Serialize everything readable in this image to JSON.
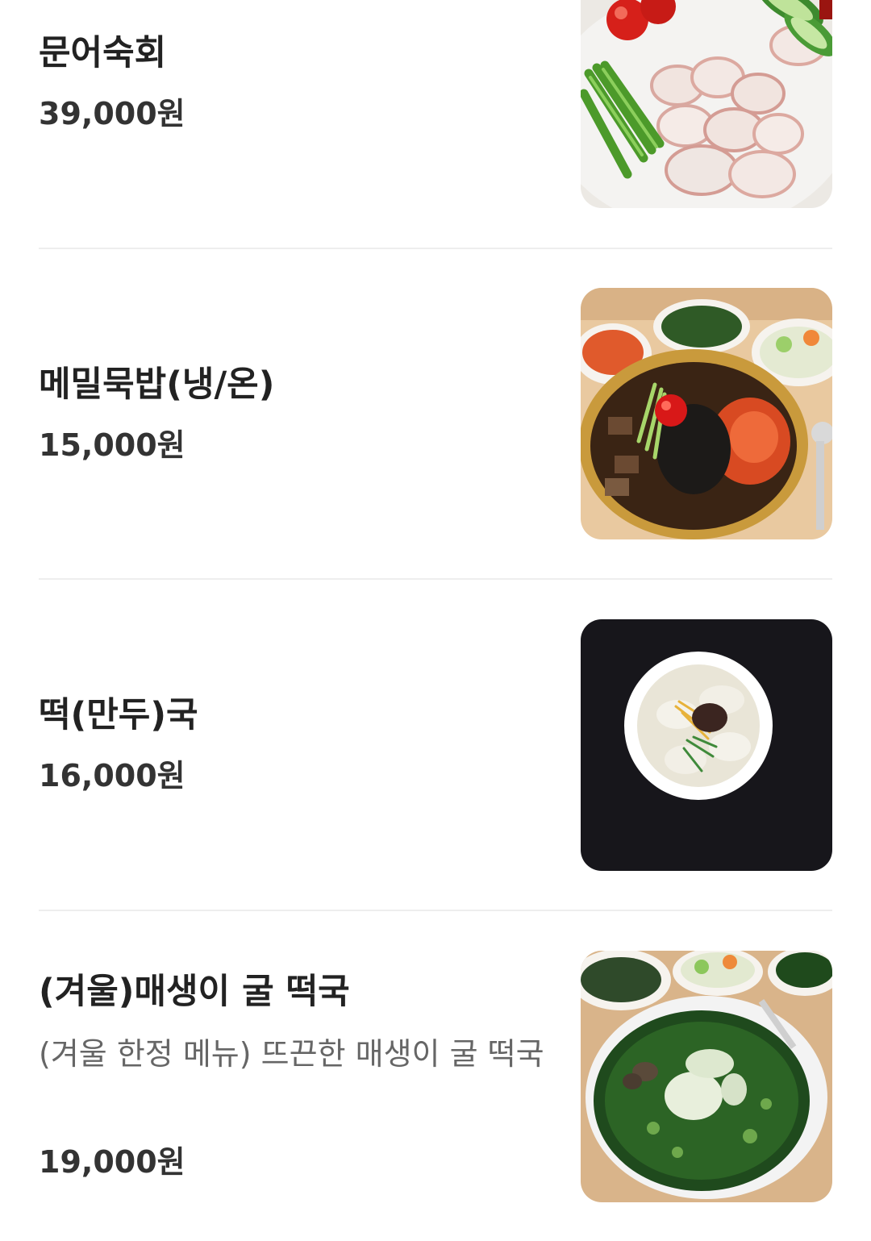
{
  "menu": {
    "items": [
      {
        "name": "문어숙회",
        "description": "",
        "price": "39,000원",
        "photo": "boiled-octopus-photo"
      },
      {
        "name": "메밀묵밥(냉/온)",
        "description": "",
        "price": "15,000원",
        "photo": "buckwheat-jelly-rice-bowl-photo"
      },
      {
        "name": "떡(만두)국",
        "description": "",
        "price": "16,000원",
        "photo": "rice-cake-dumpling-soup-photo"
      },
      {
        "name": "(겨울)매생이 굴 떡국",
        "description": "(겨울 한정 메뉴) 뜨끈한 매생이 굴 떡국",
        "price": "19,000원",
        "photo": "seaweed-oyster-rice-cake-soup-photo"
      }
    ]
  },
  "colors": {
    "background": "#ffffff",
    "name_text": "#222222",
    "description_text": "#666666",
    "price_text": "#333333",
    "divider": "#eeeeee"
  }
}
